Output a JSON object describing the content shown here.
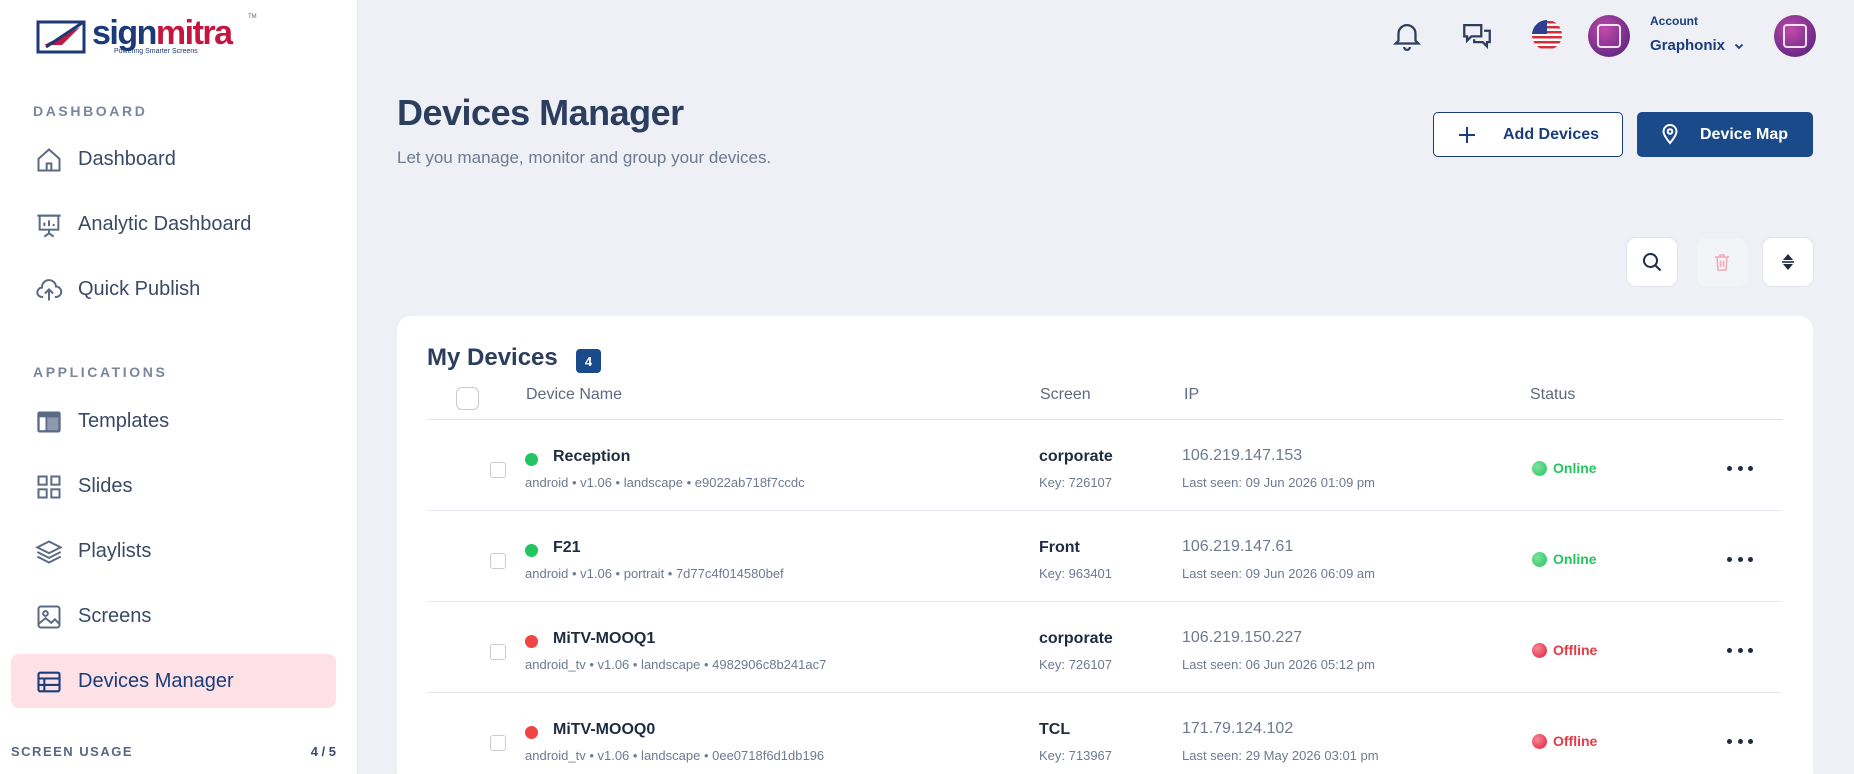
{
  "brand": {
    "sign": "sign",
    "mitra": "mitra",
    "tagline": "Powering Smarter Screens",
    "tm": "TM"
  },
  "sidebar": {
    "section_dashboard": "DASHBOARD",
    "section_applications": "APPLICATIONS",
    "items": [
      {
        "label": "Dashboard",
        "icon": "home-icon"
      },
      {
        "label": "Analytic Dashboard",
        "icon": "presentation-chart-icon"
      },
      {
        "label": "Quick Publish",
        "icon": "cloud-upload-icon"
      },
      {
        "label": "Templates",
        "icon": "template-icon"
      },
      {
        "label": "Slides",
        "icon": "grid-icon"
      },
      {
        "label": "Playlists",
        "icon": "layers-icon"
      },
      {
        "label": "Screens",
        "icon": "image-icon"
      },
      {
        "label": "Devices Manager",
        "icon": "table-icon",
        "active": true
      }
    ],
    "usage": {
      "label": "SCREEN USAGE",
      "value": "4 / 5"
    }
  },
  "header": {
    "account_label": "Account",
    "account_name": "Graphonix"
  },
  "page": {
    "title": "Devices Manager",
    "subtitle": "Let you manage, monitor and group your devices.",
    "add_button": "Add Devices",
    "map_button": "Device Map"
  },
  "devices": {
    "title": "My Devices",
    "count": "4",
    "columns": {
      "name": "Device Name",
      "screen": "Screen",
      "ip": "IP",
      "status": "Status"
    },
    "rows": [
      {
        "name": "Reception",
        "meta": "android • v1.06 • landscape • e9022ab718f7ccdc",
        "screen": "corporate",
        "key": "Key: 726107",
        "ip": "106.219.147.153",
        "seen": "Last seen: 09 Jun 2026 01:09 pm",
        "status": "Online"
      },
      {
        "name": "F21",
        "meta": "android • v1.06 • portrait • 7d77c4f014580bef",
        "screen": "Front",
        "key": "Key: 963401",
        "ip": "106.219.147.61",
        "seen": "Last seen: 09 Jun 2026 06:09 am",
        "status": "Online"
      },
      {
        "name": "MiTV-MOOQ1",
        "meta": "android_tv • v1.06 • landscape • 4982906c8b241ac7",
        "screen": "corporate",
        "key": "Key: 726107",
        "ip": "106.219.150.227",
        "seen": "Last seen: 06 Jun 2026 05:12 pm",
        "status": "Offline"
      },
      {
        "name": "MiTV-MOOQ0",
        "meta": "android_tv • v1.06 • landscape • 0ee0718f6d1db196",
        "screen": "TCL",
        "key": "Key: 713967",
        "ip": "171.79.124.102",
        "seen": "Last seen: 29 May 2026 03:01 pm",
        "status": "Offline"
      }
    ]
  },
  "colors": {
    "online": "#22c55e",
    "offline": "#ef4444",
    "primary": "#1a4a8a",
    "active_bg": "#fde1e7"
  }
}
